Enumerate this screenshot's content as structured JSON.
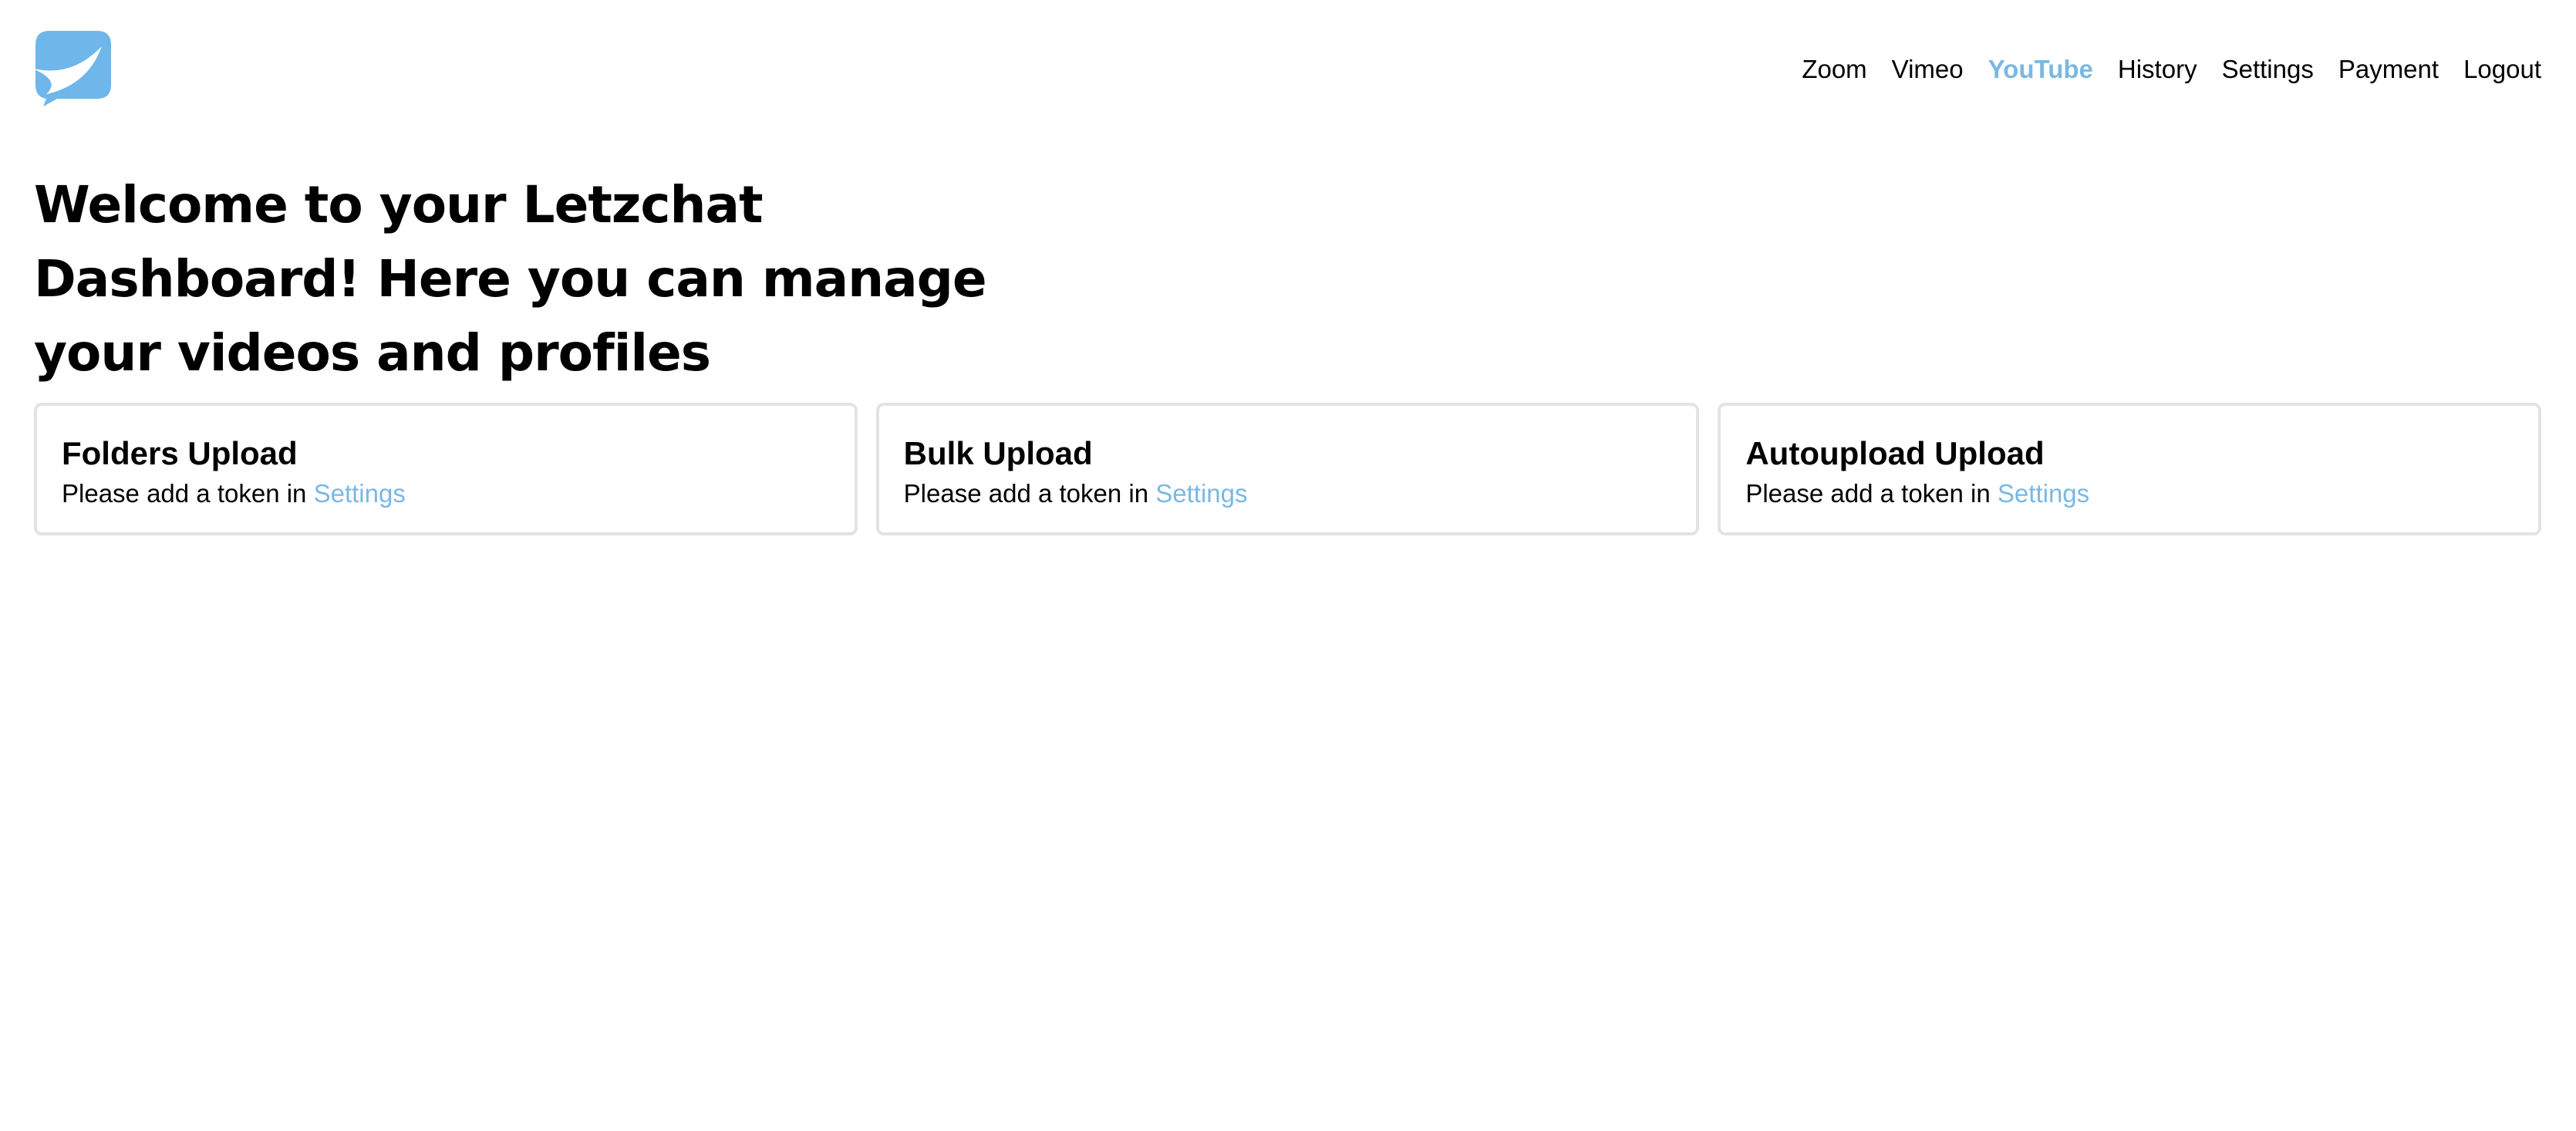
{
  "colors": {
    "accent": "#7ab8e3",
    "logo": "#6fb6ea",
    "card_border": "#e3e3e3",
    "text": "#000000"
  },
  "header": {
    "logo_icon": "chat-bubble-swoosh-icon",
    "nav": [
      {
        "label": "Zoom",
        "active": false
      },
      {
        "label": "Vimeo",
        "active": false
      },
      {
        "label": "YouTube",
        "active": true
      },
      {
        "label": "History",
        "active": false
      },
      {
        "label": "Settings",
        "active": false
      },
      {
        "label": "Payment",
        "active": false
      },
      {
        "label": "Logout",
        "active": false
      }
    ]
  },
  "main": {
    "headline": "Welcome to your Letzchat Dashboard! Here you can manage your videos and profiles",
    "cards": [
      {
        "title": "Folders Upload",
        "text": "Please add a token in",
        "link": "Settings"
      },
      {
        "title": "Bulk Upload",
        "text": "Please add a token in",
        "link": "Settings"
      },
      {
        "title": "Autoupload Upload",
        "text": "Please add a token in",
        "link": "Settings"
      }
    ]
  }
}
